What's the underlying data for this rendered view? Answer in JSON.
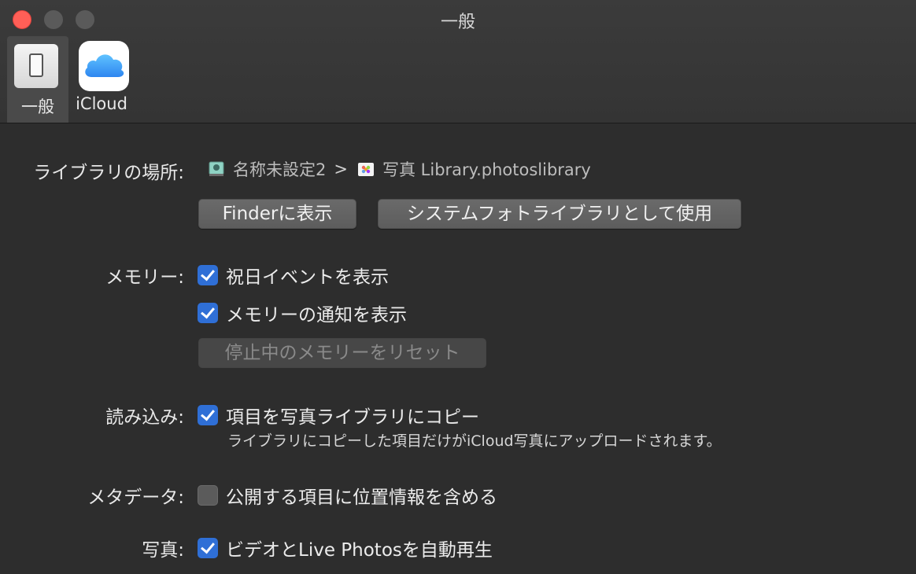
{
  "window": {
    "title": "一般",
    "colors": {
      "close": "#ff5f57",
      "accent": "#2f6fd6"
    }
  },
  "toolbar": {
    "items": [
      {
        "label": "一般",
        "icon": "general-icon",
        "selected": true
      },
      {
        "label": "iCloud",
        "icon": "icloud-icon",
        "selected": false
      }
    ]
  },
  "library": {
    "label": "ライブラリの場所:",
    "volume": "名称未設定2",
    "separator": ">",
    "library_name": "写真 Library.photoslibrary",
    "finder_button": "Finderに表示",
    "system_library_button": "システムフォトライブラリとして使用"
  },
  "memories": {
    "label": "メモリー:",
    "show_holidays": {
      "label": "祝日イベントを表示",
      "checked": true
    },
    "show_notifications": {
      "label": "メモリーの通知を表示",
      "checked": true
    },
    "reset_button": "停止中のメモリーをリセット"
  },
  "importing": {
    "label": "読み込み:",
    "copy_items": {
      "label": "項目を写真ライブラリにコピー",
      "checked": true
    },
    "note": "ライブラリにコピーした項目だけがiCloud写真にアップロードされます。"
  },
  "metadata": {
    "label": "メタデータ:",
    "include_location": {
      "label": "公開する項目に位置情報を含める",
      "checked": false
    }
  },
  "photos": {
    "label": "写真:",
    "autoplay": {
      "label": "ビデオとLive Photosを自動再生",
      "checked": true
    }
  }
}
